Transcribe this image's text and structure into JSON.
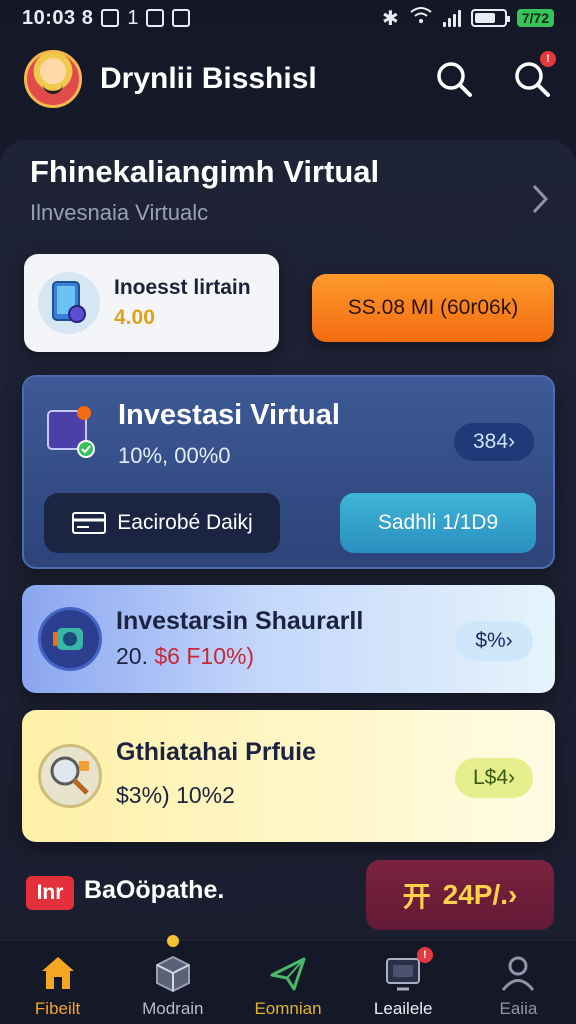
{
  "status_bar": {
    "time": "10:03 8",
    "extra": "1",
    "charge": "7/72",
    "battery_level": 0.7
  },
  "header": {
    "title": "Drynlii Bisshisl",
    "notification_count": "!"
  },
  "section": {
    "title": "Fhinekaliangimh Virtual",
    "subtitle": "Ilnvesnaia Virtualc"
  },
  "balance": {
    "label": "Inoesst lirtain",
    "value": "4.00"
  },
  "action_button": {
    "label": "SS.08 MI (60r06k)"
  },
  "virtual_card": {
    "title": "Investasi Virtual",
    "subtitle": "10%, 00%0",
    "pill": "384›",
    "left_button": "Eacirobé Daikj",
    "right_button": "Sadhli 1/1D9"
  },
  "list": [
    {
      "title": "Investarsin Shaurarll",
      "value_prefix": "20. ",
      "value_highlight": "$6 F10%)",
      "pill": "$%›"
    },
    {
      "title": "Gthiatahai Prfuie",
      "value": "$3%) 10%2",
      "pill": "L$4›"
    }
  ],
  "bottom": {
    "badge": "Inr",
    "label": "BaOöpathe.",
    "button_icon": "开",
    "button_label": "24P/.›"
  },
  "tabs": [
    {
      "label": "Fibeilt",
      "icon": "home-icon"
    },
    {
      "label": "Modrain",
      "icon": "box-icon"
    },
    {
      "label": "Eomnian",
      "icon": "send-icon"
    },
    {
      "label": "Leailele",
      "icon": "monitor-icon",
      "badge": "!"
    },
    {
      "label": "Eaiia",
      "icon": "person-icon"
    }
  ],
  "colors": {
    "accent_orange": "#f26c12",
    "card_blue": "#2d437a",
    "teal": "#2a8fc0",
    "gold": "#ffd24a",
    "badge_red": "#e3303a"
  }
}
